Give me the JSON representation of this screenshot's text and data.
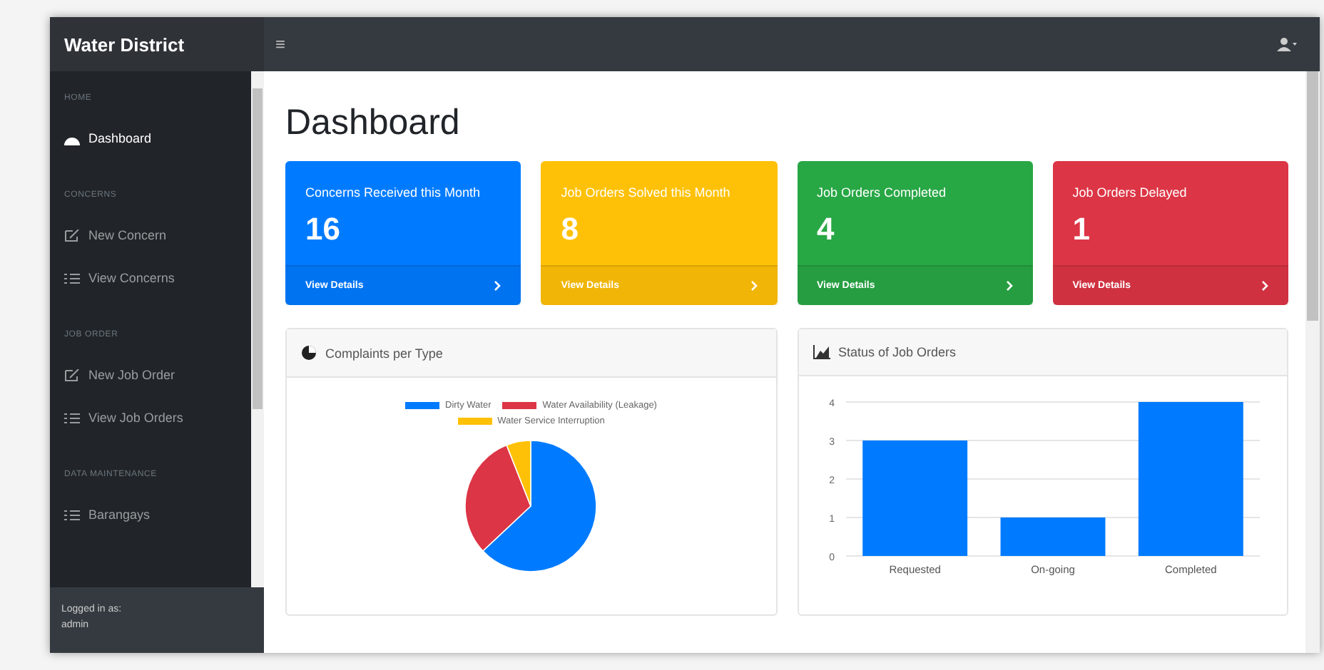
{
  "topbar": {
    "brand": "Water District",
    "menu_icon": "≡"
  },
  "sidebar": {
    "sections": [
      {
        "heading": "HOME",
        "items": [
          {
            "label": "Dashboard",
            "kind": "dashboard",
            "selected": true
          }
        ]
      },
      {
        "heading": "CONCERNS",
        "items": [
          {
            "label": "New Concern",
            "kind": "create",
            "selected": false
          },
          {
            "label": "View Concerns",
            "kind": "view",
            "selected": false
          }
        ]
      },
      {
        "heading": "JOB ORDER",
        "items": [
          {
            "label": "New Job Order",
            "kind": "create",
            "selected": false
          },
          {
            "label": "View Job Orders",
            "kind": "view",
            "selected": false
          }
        ]
      },
      {
        "heading": "DATA MAINTENANCE",
        "items": [
          {
            "label": "Barangays",
            "kind": "view",
            "selected": false
          }
        ]
      }
    ],
    "footer": {
      "label": "Logged in as:",
      "user": "admin"
    }
  },
  "page_title": "Dashboard",
  "cards": [
    {
      "title": "Concerns Received this Month",
      "value": "16",
      "link": "View Details",
      "color": "#007bff"
    },
    {
      "title": "Job Orders Solved this Month",
      "value": "8",
      "link": "View Details",
      "color": "#ffc107"
    },
    {
      "title": "Job Orders Completed",
      "value": "4",
      "link": "View Details",
      "color": "#28a745"
    },
    {
      "title": "Job Orders Delayed",
      "value": "1",
      "link": "View Details",
      "color": "#dc3545"
    }
  ],
  "pie_panel": {
    "title": "Complaints per Type",
    "legend": [
      {
        "name": "Dirty Water",
        "color": "#007bff"
      },
      {
        "name": "Water Availability (Leakage)",
        "color": "#dc3545"
      },
      {
        "name": "Water Service Interruption",
        "color": "#ffc107"
      }
    ]
  },
  "bar_panel": {
    "title": "Status of Job Orders",
    "chart_data": {
      "type": "bar",
      "categories": [
        "Requested",
        "On-going",
        "Completed"
      ],
      "series": [
        {
          "color": "#007bff",
          "values": [
            3,
            1,
            4
          ]
        }
      ],
      "ylim": [
        0,
        4
      ],
      "yticks": [
        0,
        1,
        2,
        3,
        4
      ],
      "grid": true
    }
  }
}
